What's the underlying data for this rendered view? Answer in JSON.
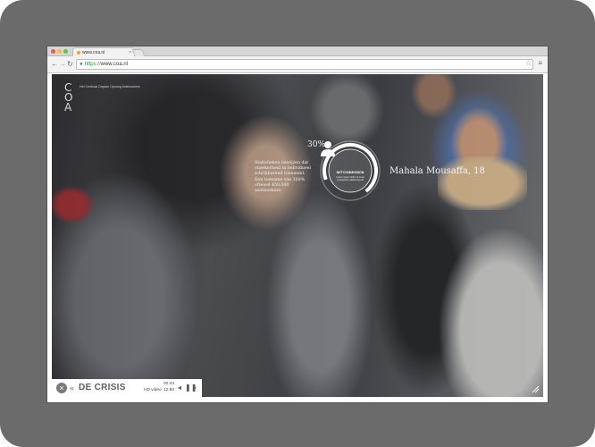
{
  "browser": {
    "tab_title": "www.coa.nl",
    "tab_close": "×",
    "url_scheme": "https://",
    "url_host": "www.coa.nl",
    "icons": {
      "back": "back-arrow-icon",
      "forward": "forward-arrow-icon",
      "reload": "reload-icon",
      "lock": "lock-icon",
      "bookmark": "star-icon",
      "menu": "menu-icon"
    }
  },
  "site": {
    "logo_lines": [
      "C",
      "O",
      "A"
    ],
    "tagline": "Het Centraal Orgaan Opvang Asielzoekers"
  },
  "badge": {
    "percent": "30%",
    "title": "NETCOMMISSION",
    "subtitle": "Lorem ipsum dolor sit amet consectetur adipiscing elit"
  },
  "statistics": {
    "text": "Statistieken bewijzen dat onzekerheid in individueel schrikbarend toeneemt. Een toename van 300% oftewel 450.000 asielzoekers."
  },
  "person": {
    "name": "Mahala Mousaffa, 18"
  },
  "player": {
    "close": "×",
    "chapter_arrow": "«",
    "chapter_title": "DE CRISIS",
    "time_current": "00:44",
    "hd_label": "HD video",
    "time_total": "12:50",
    "prev": "◂",
    "pause": "❚❚",
    "next": "▸"
  },
  "colors": {
    "device_frame": "#6b6b6b",
    "accent_white": "#ffffff",
    "url_secure": "#2a9a3c"
  }
}
